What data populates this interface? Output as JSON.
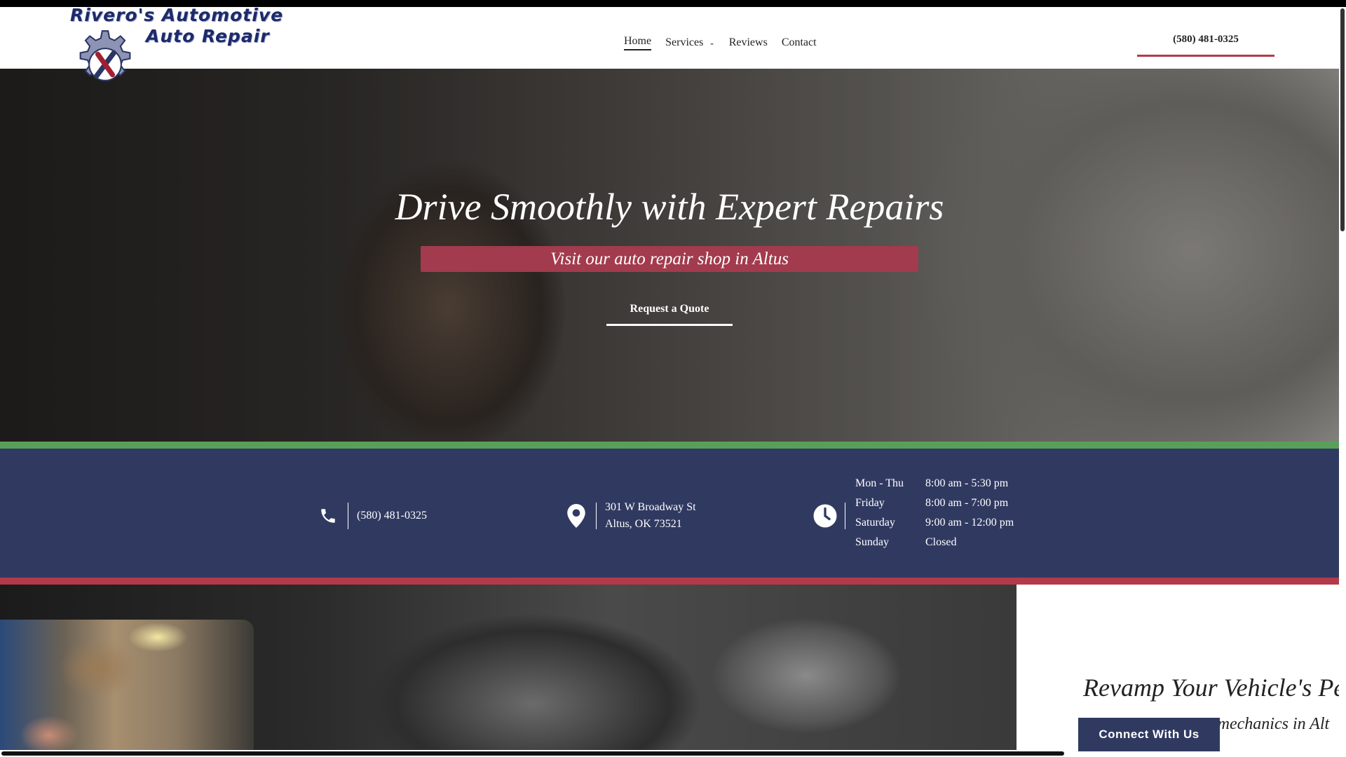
{
  "logo": {
    "line1": "Rivero's Automotive",
    "line2": "Auto Repair"
  },
  "nav": {
    "items": [
      {
        "label": "Home",
        "active": true
      },
      {
        "label": "Services",
        "caret": "⌄"
      },
      {
        "label": "Reviews"
      },
      {
        "label": "Contact"
      }
    ]
  },
  "header": {
    "phone": "(580) 481-0325"
  },
  "hero": {
    "title": "Drive Smoothly with Expert Repairs",
    "subtitle": "Visit our auto repair shop in Altus",
    "cta": "Request a Quote"
  },
  "info": {
    "phone": "(580) 481-0325",
    "address_line1": "301 W Broadway St",
    "address_line2": "Altus, OK 73521",
    "hours": [
      {
        "day": "Mon - Thu",
        "time": "8:00 am - 5:30 pm"
      },
      {
        "day": "Friday",
        "time": "8:00 am - 7:00 pm"
      },
      {
        "day": "Saturday",
        "time": "9:00 am - 12:00 pm"
      },
      {
        "day": "Sunday",
        "time": "Closed"
      }
    ]
  },
  "section": {
    "title": "Revamp Your Vehicle's Pe",
    "subtitle": "e mechanics in Alt"
  },
  "connect": {
    "label": "Connect With Us"
  },
  "colors": {
    "navy": "#303a61",
    "accent_red": "#b23a4a",
    "green": "#58a05a",
    "hero_sub_bg": "#a23b4d"
  }
}
